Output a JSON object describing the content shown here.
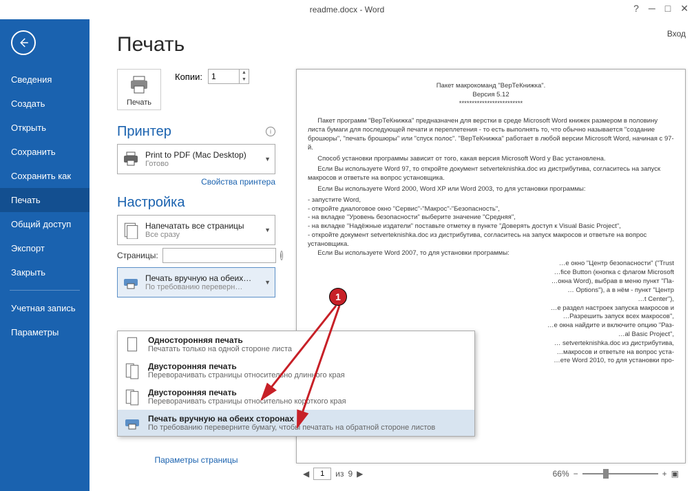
{
  "title": "readme.docx - Word",
  "signin": "Вход",
  "sidebar": {
    "items": [
      "Сведения",
      "Создать",
      "Открыть",
      "Сохранить",
      "Сохранить как",
      "Печать",
      "Общий доступ",
      "Экспорт",
      "Закрыть"
    ],
    "account": "Учетная запись",
    "options": "Параметры",
    "selected": 5
  },
  "heading": "Печать",
  "printbtn": "Печать",
  "copies_label": "Копии:",
  "copies_value": "1",
  "printer_heading": "Принтер",
  "printer": {
    "name": "Print to PDF (Mac Desktop)",
    "status": "Готово"
  },
  "printer_props": "Свойства принтера",
  "settings_heading": "Настройка",
  "allpages": {
    "title": "Напечатать все страницы",
    "sub": "Все сразу"
  },
  "pages_label": "Страницы:",
  "pages_value": "",
  "duplex": {
    "title": "Печать вручную на обеих…",
    "sub": "По требованию переверн…"
  },
  "page_setup": "Параметры страницы",
  "popup": [
    {
      "title": "Односторонняя печать",
      "sub": "Печатать только на одной стороне листа"
    },
    {
      "title": "Двусторонняя печать",
      "sub": "Переворачивать страницы относительно длинного края"
    },
    {
      "title": "Двусторонняя печать",
      "sub": "Переворачивать страницы относительно короткого края"
    },
    {
      "title": "Печать вручную на обеих сторонах",
      "sub": "По требованию переверните бумагу, чтобы печатать на обратной стороне листов"
    }
  ],
  "popup_selected": 3,
  "pager": {
    "page": "1",
    "of_label": "из",
    "total": "9"
  },
  "zoom": "66%",
  "doc": {
    "l1": "Пакет макрокоманд \"ВерТеКнижка\".",
    "l2": "Версия 5.12",
    "l3": "*************************",
    "p1": "Пакет программ \"ВерТеКнижка\" предназначен для верстки в среде Microsoft Word книжек размером в половину листа бумаги для последующей печати и переплетения - то есть выполнять то, что обычно называется \"создание брошюры\", \"печать брошюры\" или \"спуск полос\". \"ВерТеКнижка\" работает в любой версии Microsoft Word, начиная с 97-й.",
    "p2": "Способ установки программы зависит от того, какая версия Microsoft Word у Вас установлена.",
    "p3": "Если Вы используете Word 97, то откройте документ setverteknishka.doc из дистрибутива, согласитесь на запуск макросов и ответьте на вопрос установщика.",
    "p4": "Если Вы используете Word 2000, Word XP или Word 2003, то для установки программы:",
    "b1": "- запустите Word,",
    "b2": "- откройте диалоговое окно \"Сервис\"-\"Макрос\"-\"Безопасность\",",
    "b3": "- на вкладке \"Уровень безопасности\" выберите значение \"Средняя\",",
    "b4": "- на вкладке \"Надёжные издатели\" поставьте отметку в пункте \"Доверять доступ к Visual Basic Project\",",
    "b5": "- откройте документ setverteknishka.doc из дистрибутива, согласитесь на запуск макросов и ответьте на вопрос установщика.",
    "p5": "Если Вы используете Word 2007, то для установки программы:",
    "c1": "…е окно \"Центр безопасности\" (\"Trust",
    "c2": "…fice Button (кнопка с флагом Microsoft",
    "c3": "…окна Word), выбрав в меню пункт \"Па-",
    "c4": "… Options\"), а в нём - пункт \"Центр",
    "c5": "…t Center\"),",
    "c6": "…е раздел настроек запуска макросов и",
    "c7": "…Разрешить запуск всех макросов\",",
    "c8": "…е окна найдите и включите опцию \"Раз-",
    "c9": "…al Basic Project\",",
    "c10": "… setverteknishka.doc из дистрибутива,",
    "c11": "…макросов и ответьте на вопрос уста-",
    "p6": "…ете Word 2010, то для установки про-"
  },
  "marker": "1"
}
